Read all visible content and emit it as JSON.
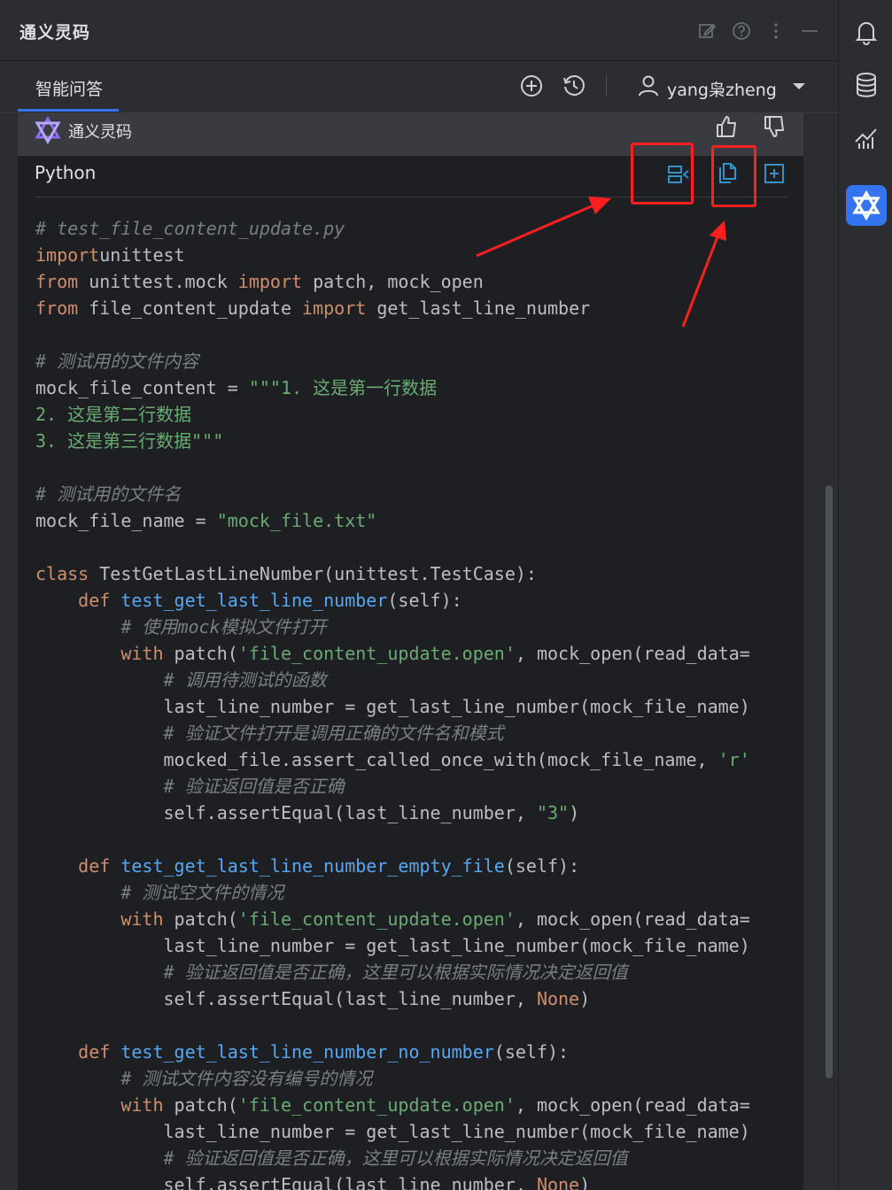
{
  "window": {
    "title": "通义灵码"
  },
  "tabs": [
    {
      "label": "智能问答"
    }
  ],
  "user": {
    "name": "yang枭zheng"
  },
  "message": {
    "author": "通义灵码"
  },
  "code_block": {
    "language": "Python",
    "lines": [
      [
        [
          "cm",
          "# test_file_content_update.py"
        ]
      ],
      [
        [
          "kw",
          "import"
        ],
        [
          "",
          "unittest"
        ]
      ],
      [
        [
          "kw",
          "from"
        ],
        [
          "",
          " unittest.mock "
        ],
        [
          "kw",
          "import"
        ],
        [
          "",
          " patch, mock_open"
        ]
      ],
      [
        [
          "kw",
          "from"
        ],
        [
          "",
          " file_content_update "
        ],
        [
          "kw",
          "import"
        ],
        [
          "",
          " get_last_line_number"
        ]
      ],
      [],
      [
        [
          "cm",
          "# 测试用的文件内容"
        ]
      ],
      [
        [
          "",
          "mock_file_content = "
        ],
        [
          "st",
          "\"\"\"1. 这是第一行数据"
        ]
      ],
      [
        [
          "st",
          "2. 这是第二行数据"
        ]
      ],
      [
        [
          "st",
          "3. 这是第三行数据\"\"\""
        ]
      ],
      [],
      [
        [
          "cm",
          "# 测试用的文件名"
        ]
      ],
      [
        [
          "",
          "mock_file_name = "
        ],
        [
          "st",
          "\"mock_file.txt\""
        ]
      ],
      [],
      [
        [
          "kw",
          "class"
        ],
        [
          "",
          " TestGetLastLineNumber(unittest.TestCase):"
        ]
      ],
      [
        [
          "",
          "    "
        ],
        [
          "kw",
          "def"
        ],
        [
          "",
          " "
        ],
        [
          "fn",
          "test_get_last_line_number"
        ],
        [
          "",
          "(self):"
        ]
      ],
      [
        [
          "",
          "        "
        ],
        [
          "cm",
          "# 使用mock模拟文件打开"
        ]
      ],
      [
        [
          "",
          "        "
        ],
        [
          "kw",
          "with"
        ],
        [
          "",
          " patch("
        ],
        [
          "st",
          "'file_content_update.open'"
        ],
        [
          "",
          ", mock_open(read_data="
        ]
      ],
      [
        [
          "",
          "            "
        ],
        [
          "cm",
          "# 调用待测试的函数"
        ]
      ],
      [
        [
          "",
          "            last_line_number = get_last_line_number(mock_file_name)"
        ]
      ],
      [
        [
          "",
          "            "
        ],
        [
          "cm",
          "# 验证文件打开是调用正确的文件名和模式"
        ]
      ],
      [
        [
          "",
          "            mocked_file.assert_called_once_with(mock_file_name, "
        ],
        [
          "st",
          "'r'"
        ]
      ],
      [
        [
          "",
          "            "
        ],
        [
          "cm",
          "# 验证返回值是否正确"
        ]
      ],
      [
        [
          "",
          "            self.assertEqual(last_line_number, "
        ],
        [
          "st",
          "\"3\""
        ],
        [
          "",
          ")"
        ]
      ],
      [],
      [
        [
          "",
          "    "
        ],
        [
          "kw",
          "def"
        ],
        [
          "",
          " "
        ],
        [
          "fn",
          "test_get_last_line_number_empty_file"
        ],
        [
          "",
          "(self):"
        ]
      ],
      [
        [
          "",
          "        "
        ],
        [
          "cm",
          "# 测试空文件的情况"
        ]
      ],
      [
        [
          "",
          "        "
        ],
        [
          "kw",
          "with"
        ],
        [
          "",
          " patch("
        ],
        [
          "st",
          "'file_content_update.open'"
        ],
        [
          "",
          ", mock_open(read_data="
        ]
      ],
      [
        [
          "",
          "            last_line_number = get_last_line_number(mock_file_name)"
        ]
      ],
      [
        [
          "",
          "            "
        ],
        [
          "cm",
          "# 验证返回值是否正确，这里可以根据实际情况决定返回值"
        ]
      ],
      [
        [
          "",
          "            self.assertEqual(last_line_number, "
        ],
        [
          "nb",
          "None"
        ],
        [
          "",
          ")"
        ]
      ],
      [],
      [
        [
          "",
          "    "
        ],
        [
          "kw",
          "def"
        ],
        [
          "",
          " "
        ],
        [
          "fn",
          "test_get_last_line_number_no_number"
        ],
        [
          "",
          "(self):"
        ]
      ],
      [
        [
          "",
          "        "
        ],
        [
          "cm",
          "# 测试文件内容没有编号的情况"
        ]
      ],
      [
        [
          "",
          "        "
        ],
        [
          "kw",
          "with"
        ],
        [
          "",
          " patch("
        ],
        [
          "st",
          "'file_content_update.open'"
        ],
        [
          "",
          ", mock_open(read_data="
        ]
      ],
      [
        [
          "",
          "            last_line_number = get_last_line_number(mock_file_name)"
        ]
      ],
      [
        [
          "",
          "            "
        ],
        [
          "cm",
          "# 验证返回值是否正确，这里可以根据实际情况决定返回值"
        ]
      ],
      [
        [
          "",
          "            self.assertEqual(last_line_number, "
        ],
        [
          "nb",
          "None"
        ],
        [
          "",
          ")"
        ]
      ]
    ]
  },
  "icons": {
    "titlebar": [
      "edit-icon",
      "help-icon",
      "more-icon",
      "minimize-icon"
    ],
    "tabbar": [
      "new-chat-icon",
      "history-icon",
      "user-icon",
      "chevron-down-icon"
    ],
    "right_strip": [
      "notification-icon",
      "database-icon",
      "chart-icon",
      "tongyi-icon"
    ],
    "message": [
      "logo-icon",
      "thumbs-up-icon",
      "thumbs-down-icon"
    ],
    "code_actions": [
      "insert-diff-icon",
      "copy-icon",
      "insert-file-icon"
    ]
  },
  "colors": {
    "accent": "#3574f0",
    "highlight_box": "#ff1f1f",
    "keyword": "#cf8e6d",
    "string": "#6aab73",
    "comment": "#7a7e85",
    "function": "#56a8f5"
  }
}
